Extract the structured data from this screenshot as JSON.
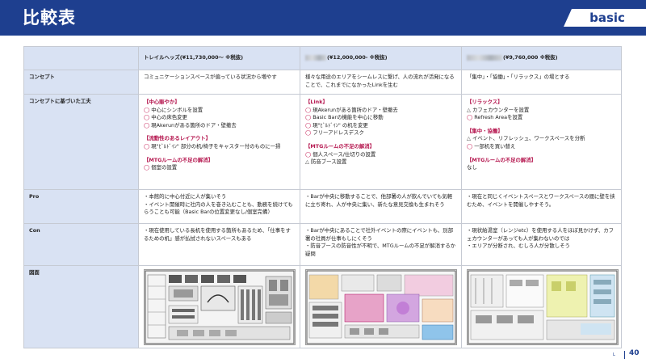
{
  "header": {
    "title": "比較表",
    "tag": "basic"
  },
  "table": {
    "columns": [
      {
        "pre": "",
        "label": "トレイルヘッズ(¥11,730,000〜 ※税抜)"
      },
      {
        "pre": "",
        "label": "(¥12,000,000- ※税抜)"
      },
      {
        "pre": "",
        "label": "(¥9,760,000 ※税抜)"
      }
    ],
    "concept": {
      "label": "コンセプト",
      "cells": [
        "コミュニケーションスペースが偏っている状況から増やす",
        "様々な用途のエリアをシームレスに繋げ、人の流れが活発になることで、これまでになかったLinkを生む",
        "「集中」・「協働」・「リラックス」の場とする"
      ]
    },
    "features": {
      "label": "コンセプトに基づいた工夫",
      "col1": {
        "sections": [
          {
            "title": "【中心賑やか】",
            "items": [
              {
                "mark": "◯",
                "text": "中心にシンボルを設置"
              },
              {
                "mark": "◯",
                "text": "中心の床色変更"
              },
              {
                "mark": "◯",
                "text": "現Akerunがある箇所のドア・壁撤去"
              }
            ]
          },
          {
            "title": "【流動性のあるレイアウト】",
            "items": [
              {
                "mark": "◯",
                "text": "現\"ﾋﾞﾙﾄﾞｲﾝ\" 部分の机/椅子をキャスター付のものに一掃"
              }
            ]
          },
          {
            "title": "【MTGルームの不足の解消】",
            "items": [
              {
                "mark": "◯",
                "text": "個室の設置"
              }
            ]
          }
        ]
      },
      "col2": {
        "sections": [
          {
            "title": "【Link】",
            "items": [
              {
                "mark": "◯",
                "text": "現Akerunがある箇所のドア・壁撤去"
              },
              {
                "mark": "◯",
                "text": "Basic Barの機能を中心に移動"
              },
              {
                "mark": "◯",
                "text": "現\"ﾋﾞﾙﾄﾞｲﾝ\" の机を変更"
              },
              {
                "mark": "◯",
                "text": "フリーアドレスデスク"
              }
            ]
          },
          {
            "title": "【MTGルームの不足の解消】",
            "items": [
              {
                "mark": "◯",
                "text": "個人スペース/仕切りの設置"
              },
              {
                "mark": "△",
                "text": "防音ブース設置"
              }
            ]
          }
        ]
      },
      "col3": {
        "sections": [
          {
            "title": "【リラックス】",
            "items": [
              {
                "mark": "△",
                "text": "カフェカウンターを設置"
              },
              {
                "mark": "◯",
                "text": "Refresh Areaを設置"
              }
            ]
          },
          {
            "title": "【集中・協働】",
            "items": [
              {
                "mark": "△",
                "text": "イベント、リフレッシュ、ワークスペースを分断"
              },
              {
                "mark": "◯",
                "text": "一部机を買い替え"
              }
            ]
          },
          {
            "title": "【MTGルームの不足の解消】",
            "items": [
              {
                "mark": "",
                "text": "なし"
              }
            ]
          }
        ]
      }
    },
    "pro": {
      "label": "Pro",
      "cells": [
        [
          "・本館的に中心付近に人が集いそう",
          "・イベント開催時に社内の人を巻き込むことも、動務を続けてもらうことも可能（Basic Barの位置変更なし/個室完備）"
        ],
        [
          "・Barが中央に移動することで、他部署の人が飲んでいても気軽に立ち寄れ、人が中央に集い、新たな意見交換も生まれそう"
        ],
        [
          "・現在と同じくイベントスペースとワークスペースの間に壁を挟むため、イベントを開催しやすそう。"
        ]
      ]
    },
    "con": {
      "label": "Con",
      "cells": [
        [
          "・現在使用している長机を使用する箇所もあるため、「仕事をするための机」感が払拭されないスペースもある"
        ],
        [
          "・Barが中央にあることで社外イベントの際にイベントも、別部署の社員が仕事もしにくそう",
          "・防音ブースの防音性が不明で、MTGルームの不足が解消するか疑問"
        ],
        [
          "・現状給湯室（レンジetc）を使用する人をほぼ見かけず、カフェカウンターがあっても人が集わないのでは",
          "・エリアが分断され、むしろ人が分散しそう"
        ]
      ]
    },
    "floorplan": {
      "label": "図面"
    }
  },
  "footer": {
    "logo": "L",
    "page": "40"
  }
}
